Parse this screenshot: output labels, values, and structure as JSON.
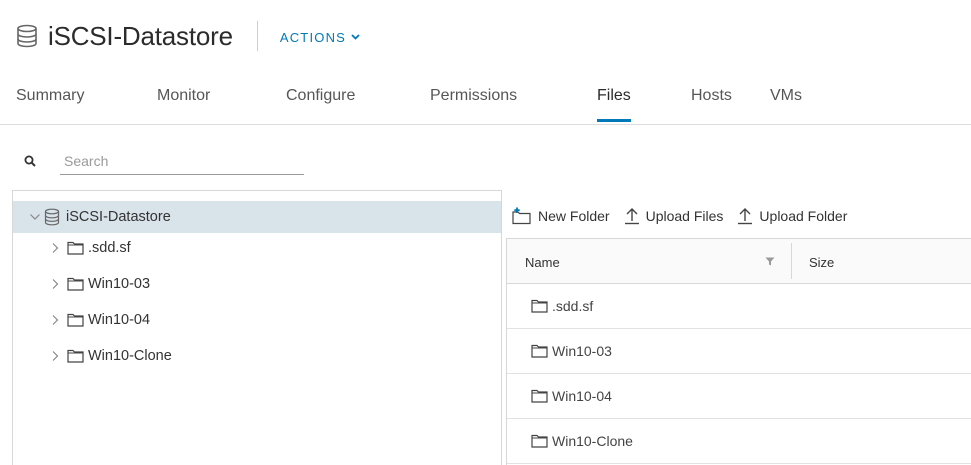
{
  "header": {
    "title": "iSCSI-Datastore",
    "actions_label": "ACTIONS",
    "icons": {
      "datastore": "datastore-icon",
      "actions": "chevron-down-icon"
    }
  },
  "tabs": [
    {
      "label": "Summary",
      "active": false
    },
    {
      "label": "Monitor",
      "active": false
    },
    {
      "label": "Configure",
      "active": false
    },
    {
      "label": "Permissions",
      "active": false
    },
    {
      "label": "Files",
      "active": true
    },
    {
      "label": "Hosts",
      "active": false
    },
    {
      "label": "VMs",
      "active": false
    }
  ],
  "search": {
    "placeholder": "Search",
    "value": "",
    "icon": "search-icon"
  },
  "tree": {
    "root": {
      "label": "iSCSI-Datastore",
      "expanded": true,
      "selected": true
    },
    "children": [
      {
        "label": ".sdd.sf"
      },
      {
        "label": "Win10-03"
      },
      {
        "label": "Win10-04"
      },
      {
        "label": "Win10-Clone"
      }
    ]
  },
  "toolbar": {
    "new_folder": "New Folder",
    "upload_files": "Upload Files",
    "upload_folder": "Upload Folder"
  },
  "files_table": {
    "columns": [
      "Name",
      "Size"
    ],
    "rows": [
      {
        "name": ".sdd.sf",
        "size": ""
      },
      {
        "name": "Win10-03",
        "size": ""
      },
      {
        "name": "Win10-04",
        "size": ""
      },
      {
        "name": "Win10-Clone",
        "size": ""
      }
    ]
  },
  "colors": {
    "accent": "#0079b8",
    "selected_row": "#d8e3ea",
    "border": "#d7d7d7"
  }
}
